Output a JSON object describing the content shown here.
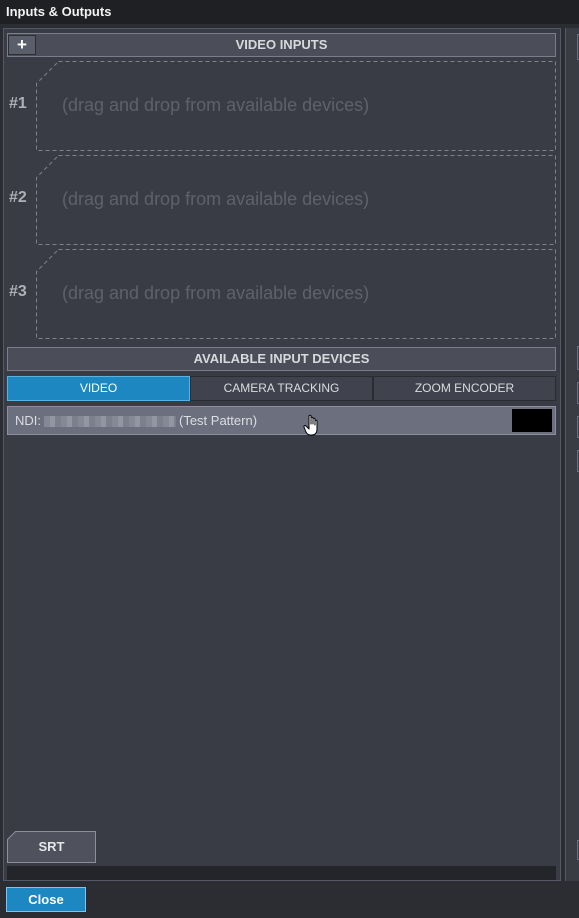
{
  "window": {
    "title": "Inputs & Outputs"
  },
  "video_inputs": {
    "header": "VIDEO INPUTS",
    "add_label": "+",
    "slots": [
      {
        "number": "#1",
        "placeholder": "(drag and drop from available devices)"
      },
      {
        "number": "#2",
        "placeholder": "(drag and drop from available devices)"
      },
      {
        "number": "#3",
        "placeholder": "(drag and drop from available devices)"
      }
    ]
  },
  "available_devices": {
    "header": "AVAILABLE INPUT DEVICES",
    "tabs": [
      {
        "label": "VIDEO",
        "active": true
      },
      {
        "label": "CAMERA TRACKING",
        "active": false
      },
      {
        "label": "ZOOM ENCODER",
        "active": false
      }
    ],
    "devices": [
      {
        "prefix": "NDI:",
        "suffix": "(Test Pattern)"
      }
    ]
  },
  "srt_tab": {
    "label": "SRT"
  },
  "close_button": {
    "label": "Close"
  },
  "colors": {
    "accent": "#1d87c2",
    "panel": "#3a3c45",
    "header": "#4b4e59",
    "device_row": "#6c6f7d"
  }
}
